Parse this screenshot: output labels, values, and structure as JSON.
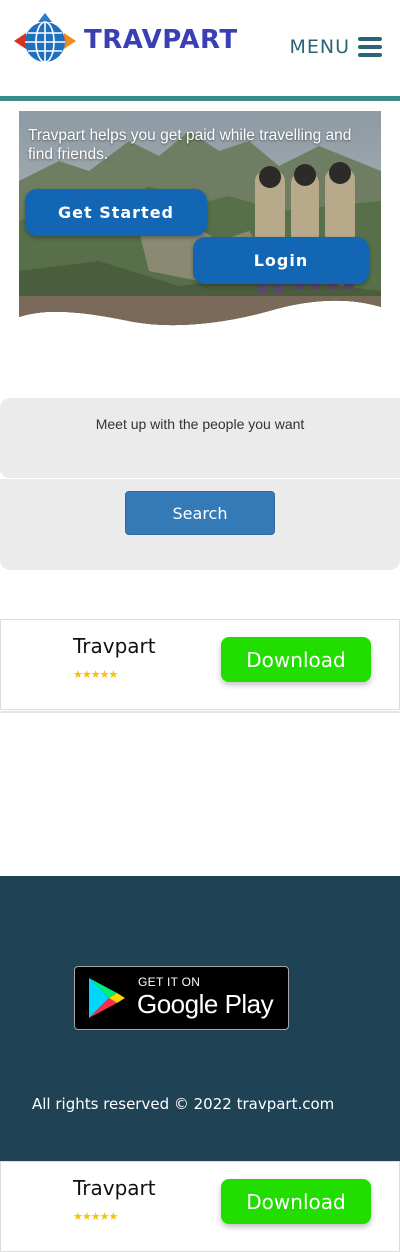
{
  "header": {
    "brand": "TRAVPART",
    "menu_label": "MENU",
    "colors": {
      "brand": "#3a3fb3",
      "menu": "#2a6478",
      "divider": "#3a8c88"
    }
  },
  "hero": {
    "tagline": "Travpart helps you get paid while travelling and find friends.",
    "get_started_label": "Get Started",
    "login_label": "Login"
  },
  "search": {
    "title": "Meet up with the people you want",
    "button_label": "Search"
  },
  "app_banner": {
    "name": "Travpart",
    "rating": "★★★★★",
    "download_label": "Download"
  },
  "footer": {
    "google_play_small": "GET IT ON",
    "google_play_big": "Google Play",
    "copyright": "All rights reserved © 2022 travpart.com"
  },
  "app_banner_bottom": {
    "name": "Travpart",
    "rating": "★★★★★",
    "download_label": "Download"
  }
}
